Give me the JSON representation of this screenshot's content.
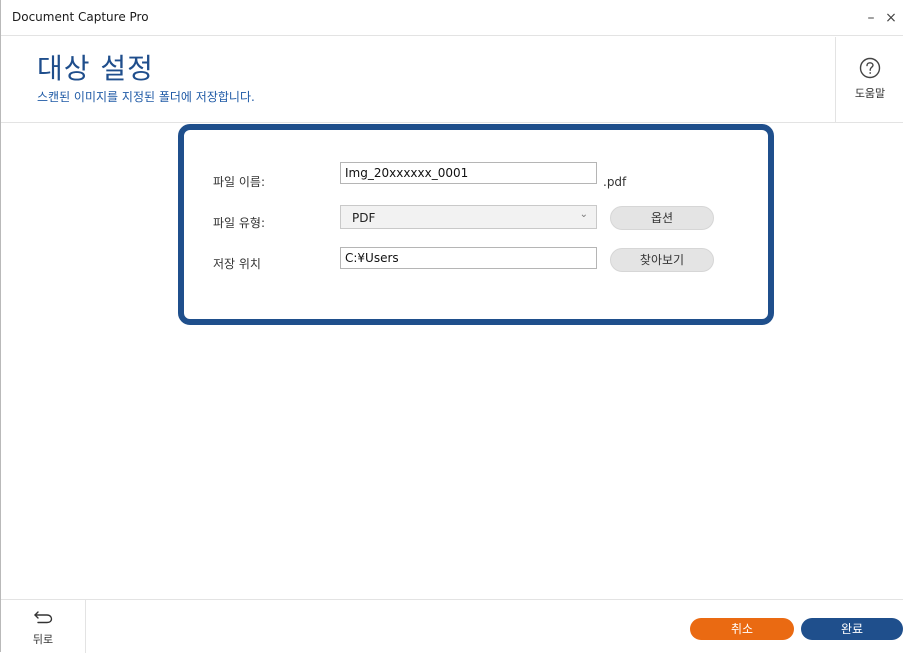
{
  "window": {
    "title": "Document Capture Pro",
    "minimize_label": "–",
    "close_label": "×"
  },
  "header": {
    "title": "대상 설정",
    "subtitle": "스캔된 이미지를 지정된 폴더에 저장합니다.",
    "help_label": "도움말",
    "help_icon": "question-circle-icon"
  },
  "form": {
    "filename_label": "파일 이름:",
    "filename_value": "Img_20xxxxxx_0001",
    "filename_suffix": ".pdf",
    "filetype_label": "파일 유형:",
    "filetype_value": "PDF",
    "options_button": "옵션",
    "location_label": "저장 위치",
    "location_value": "C:¥Users",
    "browse_button": "찾아보기"
  },
  "footer": {
    "back_label": "뒤로",
    "back_icon": "arrow-back-icon",
    "cancel_button": "취소",
    "done_button": "완료"
  },
  "colors": {
    "accent": "#1f4f8c",
    "cancel": "#ea6a12"
  }
}
